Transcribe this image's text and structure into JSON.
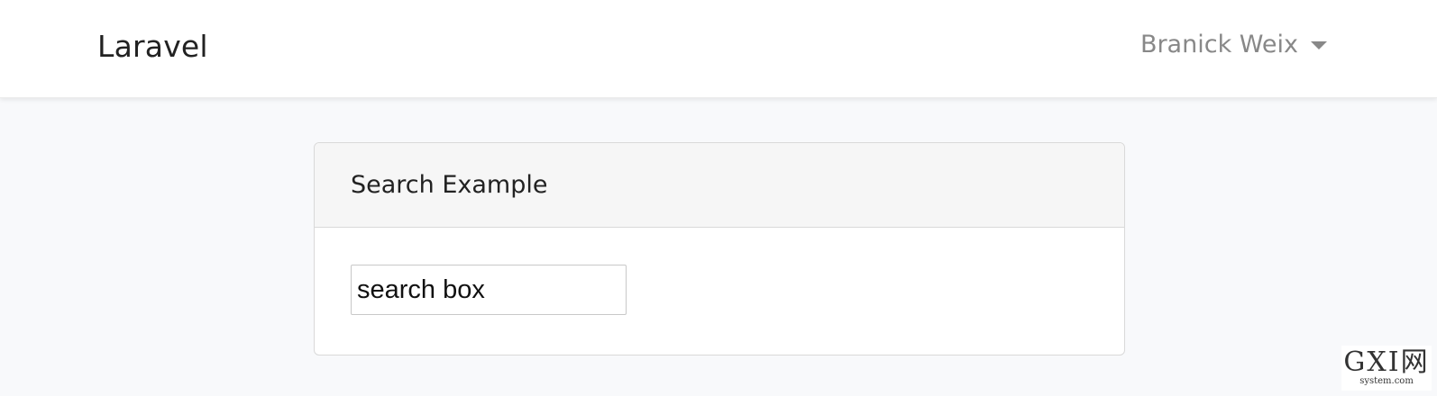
{
  "navbar": {
    "brand": "Laravel",
    "user_name": "Branick Weix",
    "caret_icon": "caret-down-icon"
  },
  "card": {
    "title": "Search Example",
    "search": {
      "value": "search box"
    }
  },
  "watermark": {
    "text": "GXI网",
    "sub": "system.com"
  }
}
